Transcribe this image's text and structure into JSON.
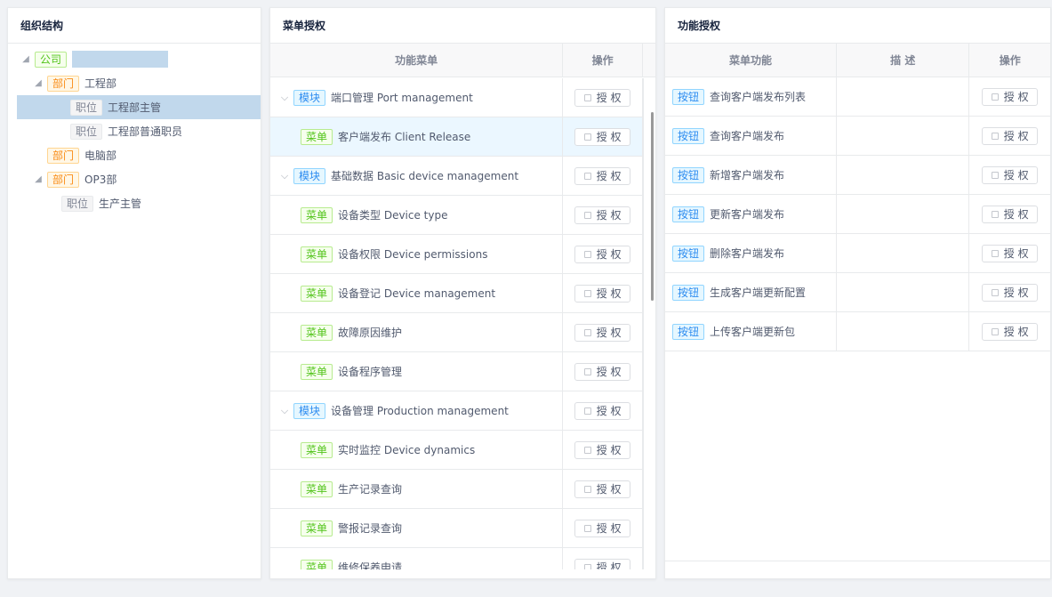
{
  "org": {
    "title": "组织结构",
    "nodes": [
      {
        "tag": "公司",
        "label": "",
        "type": "company"
      },
      {
        "tag": "部门",
        "label": "工程部",
        "type": "dept"
      },
      {
        "tag": "职位",
        "label": "工程部主管",
        "type": "position"
      },
      {
        "tag": "职位",
        "label": "工程部普通职员",
        "type": "position"
      },
      {
        "tag": "部门",
        "label": "电脑部",
        "type": "dept"
      },
      {
        "tag": "部门",
        "label": "OP3部",
        "type": "dept"
      },
      {
        "tag": "职位",
        "label": "生产主管",
        "type": "position"
      }
    ]
  },
  "menu": {
    "title": "菜单授权",
    "columns": [
      "功能菜单",
      "操作"
    ],
    "auth_label": "授 权",
    "rows": [
      {
        "tag": "模块",
        "label": "端口管理 Port management"
      },
      {
        "tag": "菜单",
        "label": "客户端发布 Client Release"
      },
      {
        "tag": "模块",
        "label": "基础数据 Basic device management"
      },
      {
        "tag": "菜单",
        "label": "设备类型 Device type"
      },
      {
        "tag": "菜单",
        "label": "设备权限 Device permissions"
      },
      {
        "tag": "菜单",
        "label": "设备登记 Device management"
      },
      {
        "tag": "菜单",
        "label": "故障原因维护"
      },
      {
        "tag": "菜单",
        "label": "设备程序管理"
      },
      {
        "tag": "模块",
        "label": "设备管理 Production management"
      },
      {
        "tag": "菜单",
        "label": "实时监控 Device dynamics"
      },
      {
        "tag": "菜单",
        "label": "生产记录查询"
      },
      {
        "tag": "菜单",
        "label": "警报记录查询"
      },
      {
        "tag": "菜单",
        "label": "维修保养申请"
      }
    ]
  },
  "func": {
    "title": "功能授权",
    "columns": [
      "菜单功能",
      "描 述",
      "操作"
    ],
    "auth_label": "授 权",
    "rows": [
      {
        "tag": "按钮",
        "label": "查询客户端发布列表",
        "desc": ""
      },
      {
        "tag": "按钮",
        "label": "查询客户端发布",
        "desc": ""
      },
      {
        "tag": "按钮",
        "label": "新增客户端发布",
        "desc": ""
      },
      {
        "tag": "按钮",
        "label": "更新客户端发布",
        "desc": ""
      },
      {
        "tag": "按钮",
        "label": "删除客户端发布",
        "desc": ""
      },
      {
        "tag": "按钮",
        "label": "生成客户端更新配置",
        "desc": ""
      },
      {
        "tag": "按钮",
        "label": "上传客户端更新包",
        "desc": ""
      }
    ]
  },
  "colors": {
    "selected": "#c1d8ec",
    "hover_row": "#ebf7ff"
  }
}
